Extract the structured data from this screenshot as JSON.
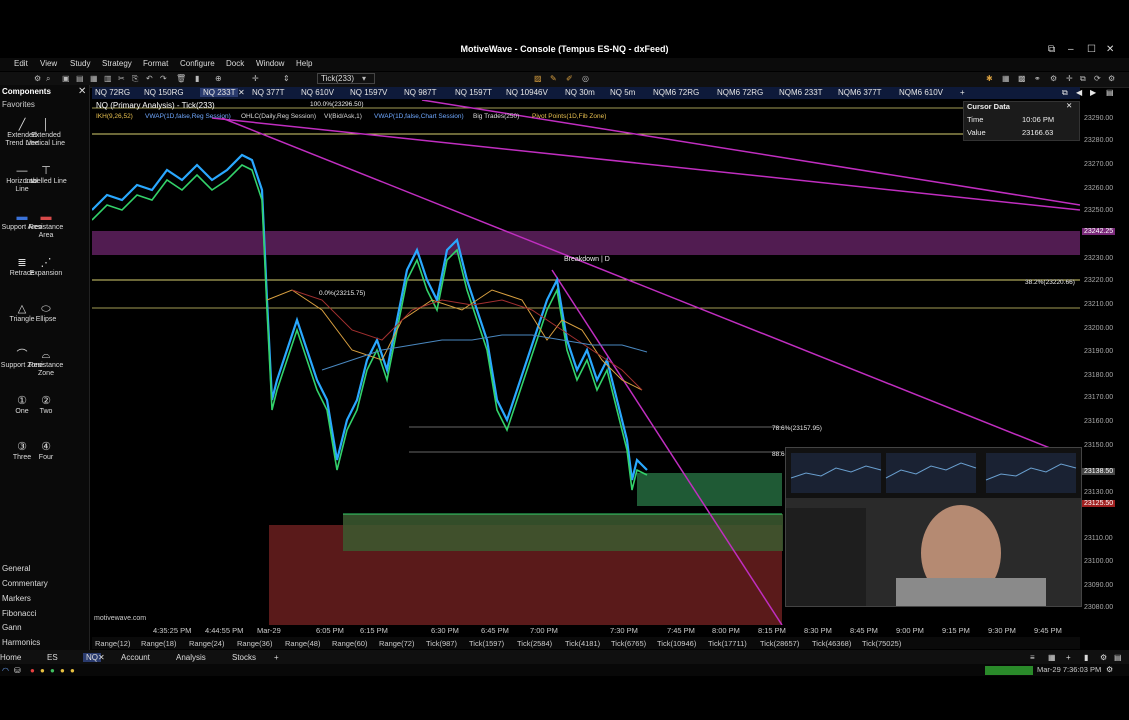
{
  "window": {
    "title": "MotiveWave - Console (Tempus ES-NQ - dxFeed)"
  },
  "menu": [
    "Edit",
    "View",
    "Study",
    "Strategy",
    "Format",
    "Configure",
    "Dock",
    "Window",
    "Help"
  ],
  "toolbar": {
    "bar_type": "Tick(233)"
  },
  "tabs": [
    {
      "label": "NQ 72RG"
    },
    {
      "label": "NQ 150RG"
    },
    {
      "label": "NQ 233T",
      "active": true
    },
    {
      "label": "NQ 377T"
    },
    {
      "label": "NQ 610V"
    },
    {
      "label": "NQ 1597V"
    },
    {
      "label": "NQ 987T"
    },
    {
      "label": "NQ 1597T"
    },
    {
      "label": "NQ 10946V"
    },
    {
      "label": "NQ 30m"
    },
    {
      "label": "NQ 5m"
    },
    {
      "label": "NQM6 72RG"
    },
    {
      "label": "NQM6 72RG"
    },
    {
      "label": "NQM6 233T"
    },
    {
      "label": "NQM6 377T"
    },
    {
      "label": "NQM6 610V"
    }
  ],
  "sidebar": {
    "header": "Components",
    "subheader": "Favorites",
    "tools": [
      {
        "label": "Extended Trend Line",
        "icon": "line-icon"
      },
      {
        "label": "Extended Vertical Line",
        "icon": "vertical-line-icon"
      },
      {
        "label": "Horizontal Line",
        "icon": "horizontal-line-icon"
      },
      {
        "label": "Labelled Line",
        "icon": "labelled-line-icon"
      },
      {
        "label": "Support Area",
        "icon": "support-area-icon"
      },
      {
        "label": "Resistance Area",
        "icon": "resistance-area-icon"
      },
      {
        "label": "Retrace",
        "icon": "retrace-icon"
      },
      {
        "label": "Expansion",
        "icon": "expansion-icon"
      },
      {
        "label": "Triangle",
        "icon": "triangle-icon"
      },
      {
        "label": "Ellipse",
        "icon": "ellipse-icon"
      },
      {
        "label": "Support Zone",
        "icon": "support-zone-icon"
      },
      {
        "label": "Resistance Zone",
        "icon": "resistance-zone-icon"
      },
      {
        "label": "One",
        "icon": "one-icon"
      },
      {
        "label": "Two",
        "icon": "two-icon"
      },
      {
        "label": "Three",
        "icon": "three-icon"
      },
      {
        "label": "Four",
        "icon": "four-icon"
      }
    ],
    "categories": [
      "General",
      "Commentary",
      "Markers",
      "Fibonacci",
      "Gann",
      "Harmonics"
    ]
  },
  "chart": {
    "title": "NQ (Primary Analysis) - Tick(233)",
    "top_label": "100.0%(23296.50)",
    "indicators": [
      "IKH(9,26,52)",
      "VWAP(1D,false,Reg Session)",
      "OHLC(Daily,Reg Session)",
      "VI(Bid/Ask,1)",
      "VWAP(1D,false,Chart Session)",
      "Big Trades(250)",
      "Pivot Points(1D,Fib Zone)"
    ],
    "annotations": {
      "breakdown": "Breakdown | D",
      "fib_38": "38.2%(23220.66)",
      "fib_0": "0.0%(23215.75)",
      "fib_786": "78.6%(23157.95)",
      "fib_886": "88.6"
    },
    "watermark": "motivewave.com",
    "price_axis": [
      "23290.00",
      "23280.00",
      "23270.00",
      "23260.00",
      "23250.00",
      "23242.25",
      "23230.00",
      "23220.00",
      "23210.00",
      "23200.00",
      "23190.00",
      "23180.00",
      "23170.00",
      "23160.00",
      "23150.00",
      "23140.00",
      "23138.50",
      "23130.00",
      "23125.50",
      "23110.00",
      "23100.00",
      "23090.00",
      "23080.00"
    ],
    "time_axis": [
      "4:35:25 PM",
      "4:44:55 PM",
      "Mar-29",
      "6:05 PM",
      "6:15 PM",
      "6:30 PM",
      "6:45 PM",
      "7:00 PM",
      "7:30 PM",
      "7:45 PM",
      "8:00 PM",
      "8:15 PM",
      "8:30 PM",
      "8:45 PM",
      "9:00 PM",
      "9:15 PM",
      "9:30 PM",
      "9:45 PM"
    ]
  },
  "cursor_data": {
    "title": "Cursor Data",
    "time_label": "Time",
    "time_value": "10:06 PM",
    "value_label": "Value",
    "value_value": "23166.63"
  },
  "range_bar": [
    "Range(12)",
    "Range(18)",
    "Range(24)",
    "Range(36)",
    "Range(48)",
    "Range(60)",
    "Range(72)",
    "Tick(987)",
    "Tick(1597)",
    "Tick(2584)",
    "Tick(4181)",
    "Tick(6765)",
    "Tick(10946)",
    "Tick(17711)",
    "Tick(28657)",
    "Tick(46368)",
    "Tick(75025)"
  ],
  "bottom_tabs": [
    {
      "label": "Home"
    },
    {
      "label": "ES"
    },
    {
      "label": "NQ"
    },
    {
      "label": "Account"
    },
    {
      "label": "Analysis"
    },
    {
      "label": "Stocks"
    }
  ],
  "status": {
    "datetime": "Mar-29 7:36:03 PM"
  },
  "colors": {
    "accent_blue": "#0e1a3a",
    "trendline": "#c02ec0",
    "resistance_zone": "#5a1f5a",
    "support_zone": "#1f5a35",
    "demand_zone": "#5a1a1a"
  }
}
